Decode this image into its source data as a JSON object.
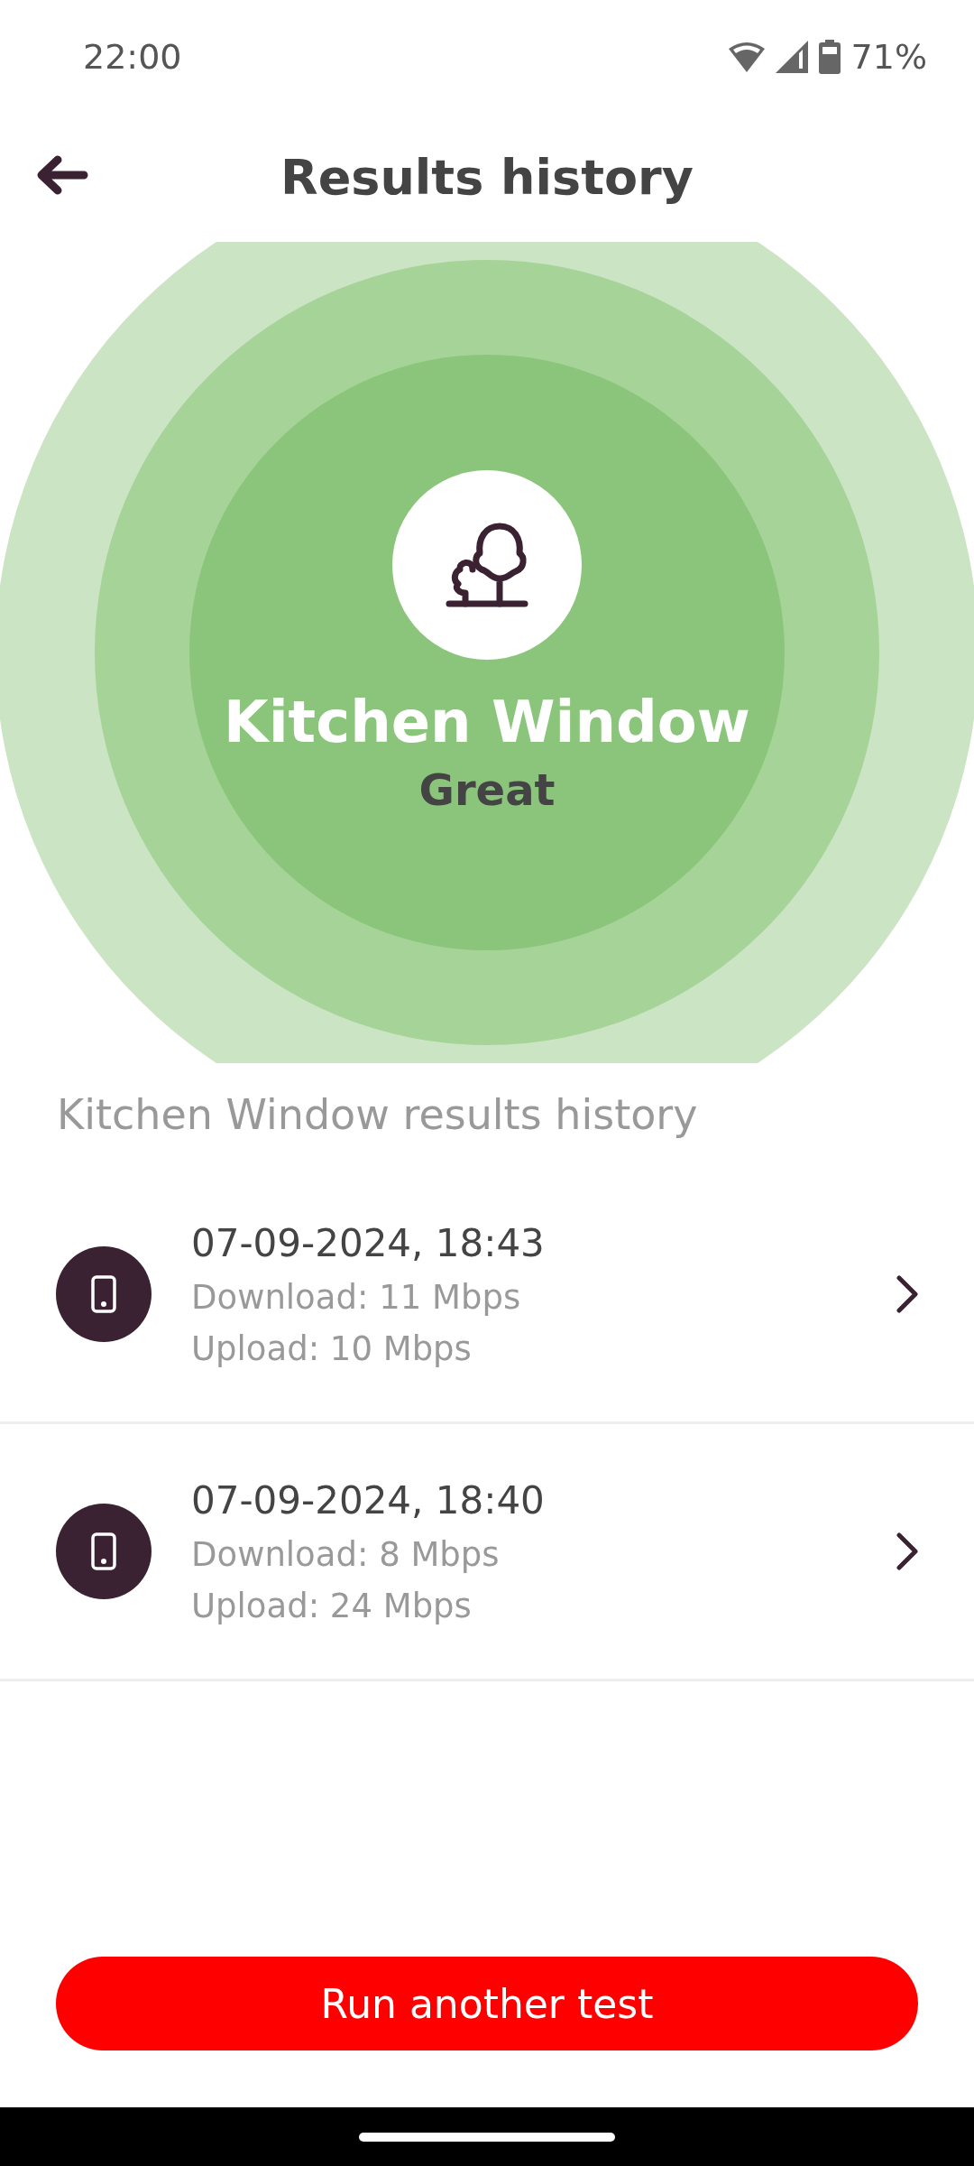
{
  "status_bar": {
    "time": "22:00",
    "battery": "71%"
  },
  "header": {
    "title": "Results history"
  },
  "location": {
    "name": "Kitchen Window",
    "rating": "Great"
  },
  "section_title": "Kitchen Window results history",
  "results": [
    {
      "datetime": "07-09-2024, 18:43",
      "download": "Download: 11 Mbps",
      "upload": "Upload: 10 Mbps"
    },
    {
      "datetime": "07-09-2024, 18:40",
      "download": "Download: 8 Mbps",
      "upload": "Upload: 24 Mbps"
    }
  ],
  "primary_button": "Run another test"
}
